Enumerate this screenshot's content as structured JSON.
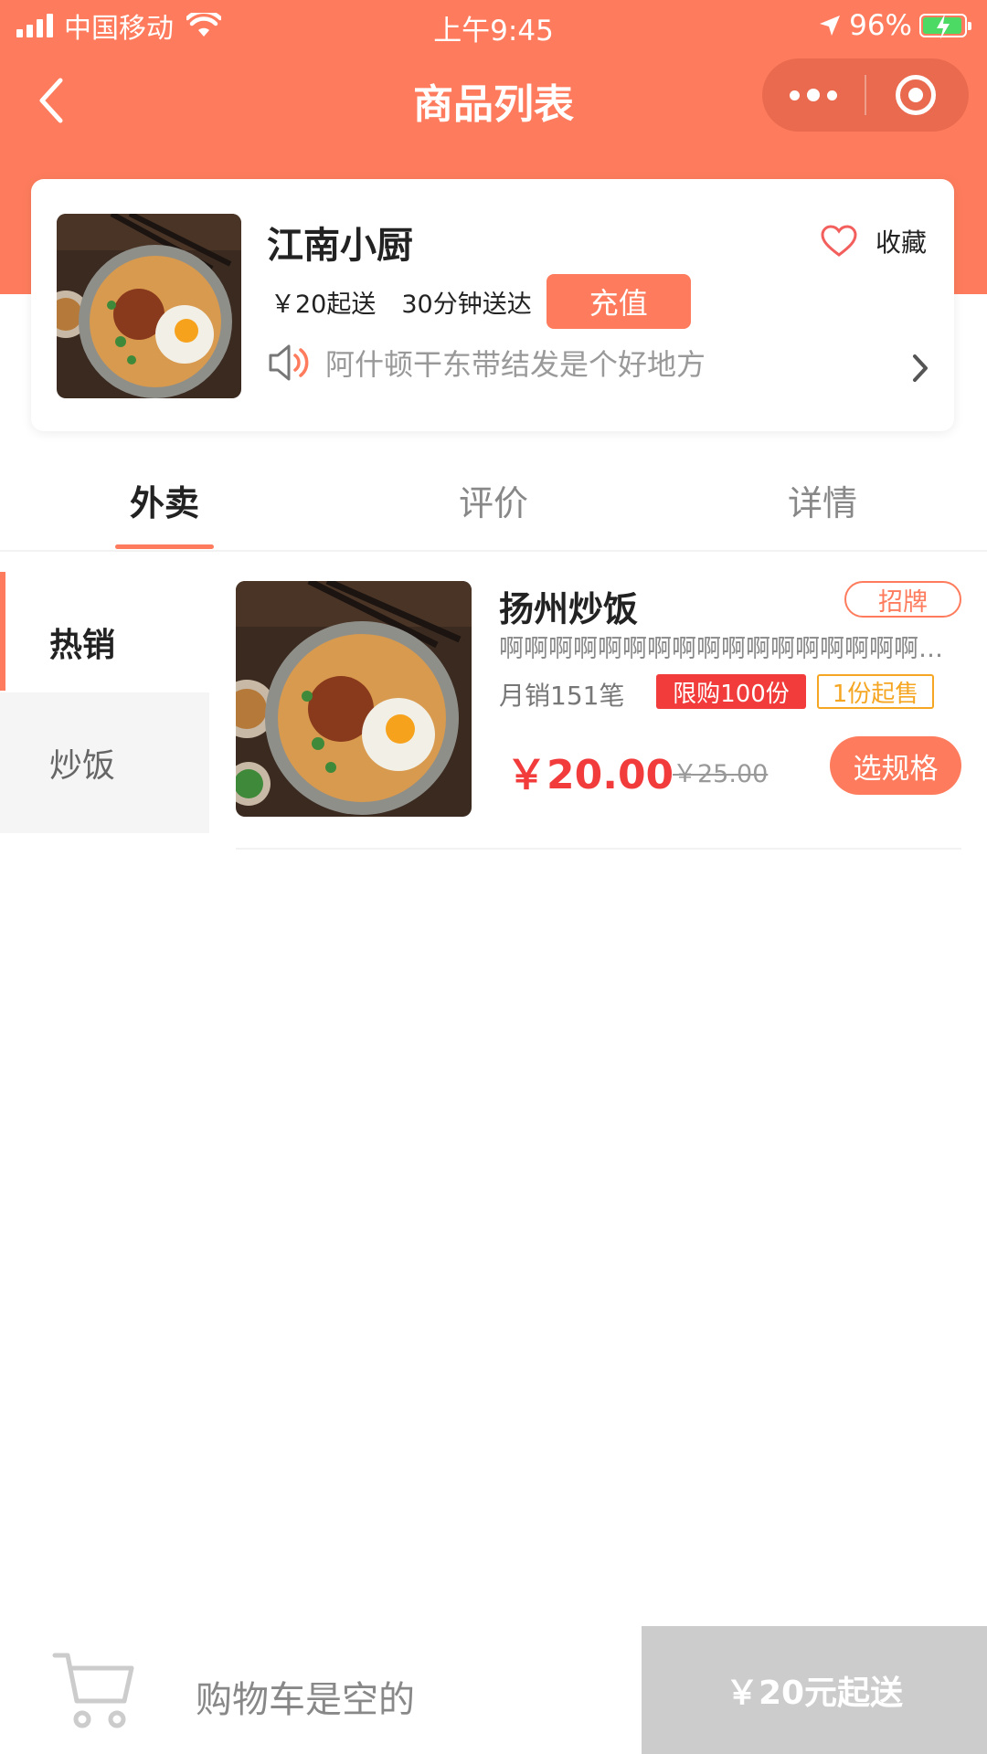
{
  "status_bar": {
    "carrier": "中国移动",
    "time": "上午9:45",
    "battery_percent": "96%"
  },
  "nav": {
    "title": "商品列表"
  },
  "shop": {
    "name": "江南小厨",
    "favorite_label": "收藏",
    "min_order": "￥20起送",
    "delivery_time": "30分钟送达",
    "recharge_label": "充值",
    "notice": "阿什顿干东带结发是个好地方"
  },
  "tabs": [
    {
      "label": "外卖",
      "active": true
    },
    {
      "label": "评价",
      "active": false
    },
    {
      "label": "详情",
      "active": false
    }
  ],
  "categories": [
    {
      "label": "热销",
      "active": true
    },
    {
      "label": "炒饭",
      "active": false
    }
  ],
  "products": [
    {
      "name": "扬州炒饭",
      "badge": "招牌",
      "description": "啊啊啊啊啊啊啊啊啊啊啊啊啊啊啊啊啊啊啊啊",
      "sales": "月销151笔",
      "limit_tag": "限购100份",
      "min_tag": "1份起售",
      "price": "￥20.00",
      "original_price": "￥25.00",
      "spec_button": "选规格"
    }
  ],
  "cart": {
    "empty_text": "购物车是空的",
    "checkout_label": "￥20元起送"
  },
  "colors": {
    "brand": "#fe7c5d",
    "price_red": "#f23b3b",
    "tag_orange": "#f5a623",
    "disabled_gray": "#cccccc"
  }
}
